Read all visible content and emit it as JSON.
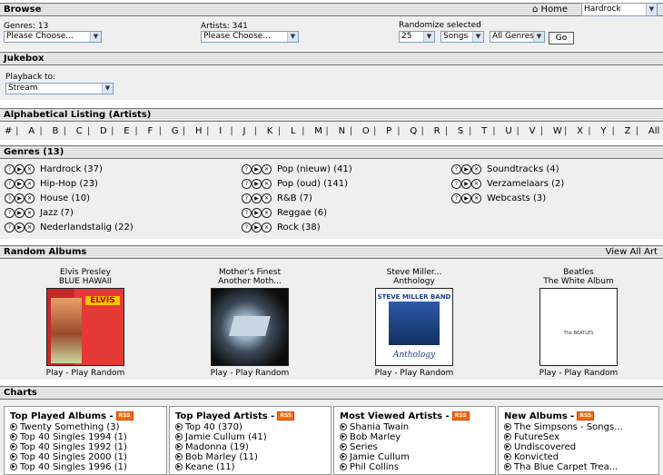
{
  "browse": {
    "title": "Browse",
    "home_label": "Home",
    "theme_select": "Hardrock",
    "genres_label": "Genres: 13",
    "genres_select": "Please Choose...",
    "artists_label": "Artists: 341",
    "artists_select": "Please Choose...",
    "randomize_label": "Randomize selected",
    "rand_count": "25",
    "rand_type": "Songs",
    "rand_genre": "All Genres",
    "go_label": "Go"
  },
  "jukebox": {
    "title": "Jukebox",
    "playback_label": "Playback to:",
    "playback_select": "Stream"
  },
  "alpha": {
    "title": "Alphabetical Listing (Artists)",
    "letters": [
      "#",
      "A",
      "B",
      "C",
      "D",
      "E",
      "F",
      "G",
      "H",
      "I",
      "J",
      "K",
      "L",
      "M",
      "N",
      "O",
      "P",
      "Q",
      "R",
      "S",
      "T",
      "U",
      "V",
      "W",
      "X",
      "Y",
      "Z",
      "All"
    ]
  },
  "genres": {
    "title": "Genres (13)",
    "items": [
      {
        "label": "Hardrock (37)"
      },
      {
        "label": "Hip-Hop (23)"
      },
      {
        "label": "House (10)"
      },
      {
        "label": "Jazz (7)"
      },
      {
        "label": "Nederlandstalig (22)"
      },
      {
        "label": "Pop (nieuw) (41)"
      },
      {
        "label": "Pop (oud) (141)"
      },
      {
        "label": "R&B (7)"
      },
      {
        "label": "Reggae (6)"
      },
      {
        "label": "Rock (38)"
      },
      {
        "label": "Soundtracks (4)"
      },
      {
        "label": "Verzamelaars (2)"
      },
      {
        "label": "Webcasts (3)"
      }
    ]
  },
  "random_albums": {
    "title": "Random Albums",
    "view_all": "View All Art",
    "play_label": "Play",
    "separator": " - ",
    "play_random_label": "Play Random",
    "albums": [
      {
        "artist": "Elvis Presley",
        "album": "BLUE HAWAII",
        "cover_text": "ELVIS"
      },
      {
        "artist": "Mother's Finest",
        "album": "Another Moth...",
        "cover_text": ""
      },
      {
        "artist": "Steve Miller...",
        "album": "Anthology",
        "cover_text": "STEVE MILLER BAND",
        "cover_text2": "Anthology"
      },
      {
        "artist": "Beatles",
        "album": "The White Album",
        "cover_text": "The BEATLES"
      }
    ]
  },
  "charts": {
    "title": "Charts",
    "rss_label": "RSS",
    "sections": [
      {
        "title": "Top Played Albums -",
        "items": [
          "Twenty Something (3)",
          "Top 40 Singles 1994 (1)",
          "Top 40 Singles 1992 (1)",
          "Top 40 Singles 2000 (1)",
          "Top 40 Singles 1996 (1)"
        ]
      },
      {
        "title": "Top Played Artists -",
        "items": [
          "Top 40 (370)",
          "Jamie Cullum (41)",
          "Madonna (19)",
          "Bob Marley (11)",
          "Keane (11)"
        ]
      },
      {
        "title": "Most Viewed Artists -",
        "items": [
          "Shania Twain",
          "Bob Marley",
          "Series",
          "Jamie Cullum",
          "Phil Collins"
        ]
      },
      {
        "title": "New Albums -",
        "items": [
          "The Simpsons - Songs...",
          "FutureSex",
          "Undiscovered",
          "Konvicted",
          "Tha Blue Carpet Trea..."
        ]
      }
    ]
  }
}
